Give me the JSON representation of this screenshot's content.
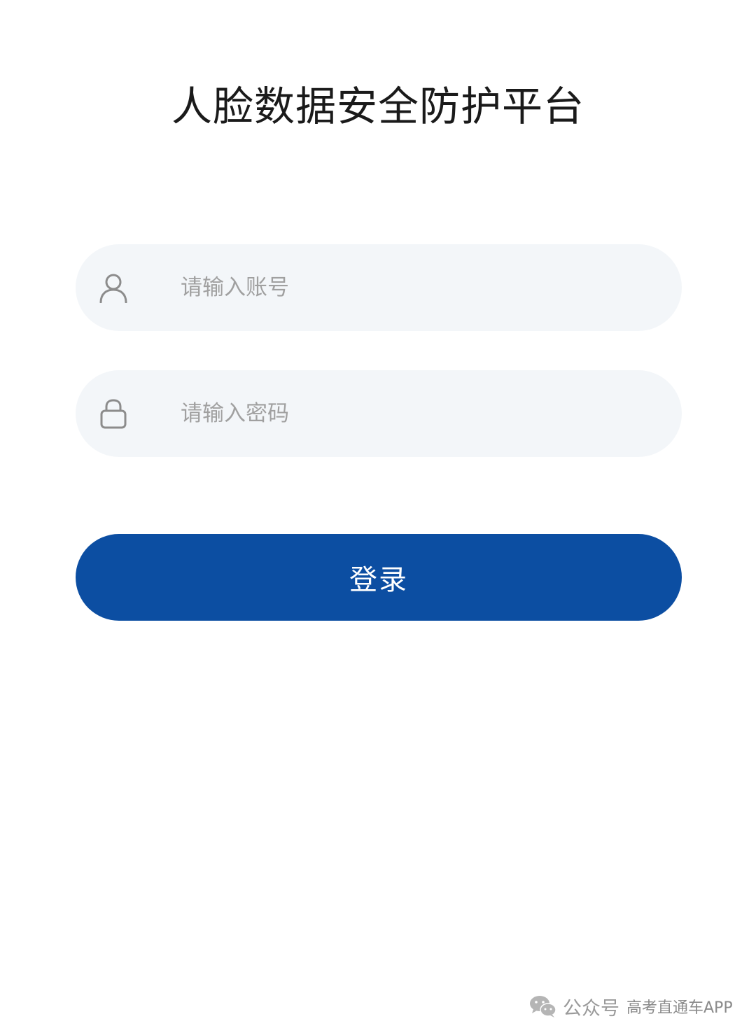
{
  "title": "人脸数据安全防护平台",
  "username_field": {
    "icon": "user-icon",
    "placeholder": "请输入账号",
    "value": ""
  },
  "password_field": {
    "icon": "lock-icon",
    "placeholder": "请输入密码",
    "value": ""
  },
  "login_button": {
    "label": "登录",
    "color": "#0c4ea2"
  },
  "footer": {
    "icon": "wechat-icon",
    "account_type": "公众号",
    "account_name": "高考直通车APP"
  },
  "colors": {
    "field_background": "#f3f6f9",
    "placeholder": "#a0a0a0",
    "title": "#1a1a1a"
  }
}
